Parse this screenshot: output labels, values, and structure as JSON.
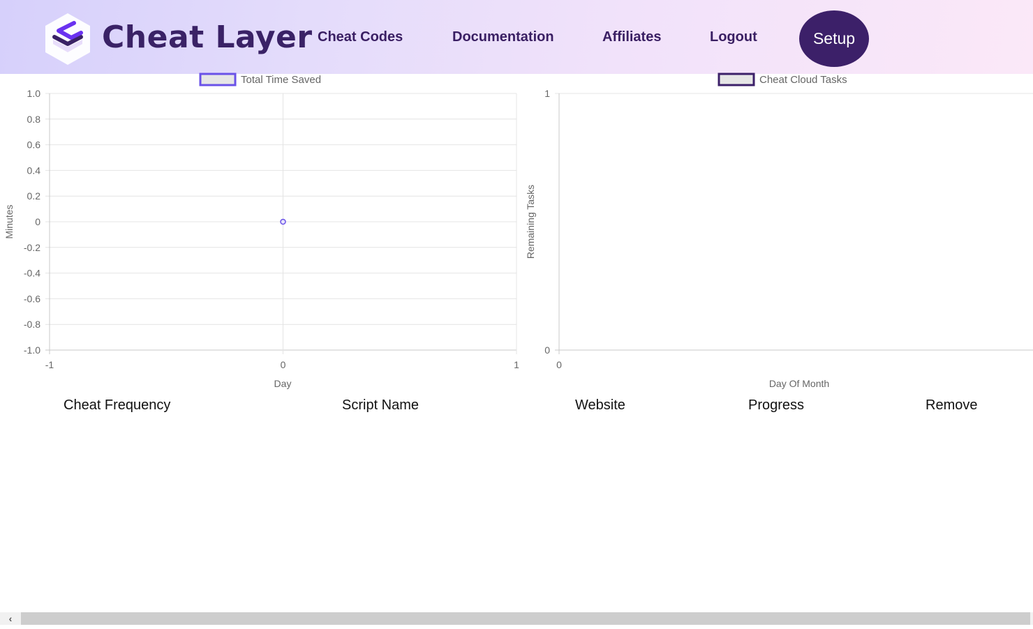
{
  "header": {
    "brand": "Cheat Layer",
    "logo_icon": "layers-icon",
    "nav": [
      {
        "label": "Cheat Codes"
      },
      {
        "label": "Documentation"
      },
      {
        "label": "Affiliates"
      },
      {
        "label": "Logout"
      }
    ],
    "setup_label": "Setup"
  },
  "colors": {
    "brand": "#3a2266",
    "accent": "#3c2069",
    "series1": "#6a52e8",
    "series2": "#3c2069"
  },
  "chart_data": [
    {
      "type": "line",
      "title": "",
      "legend": [
        "Total Time Saved"
      ],
      "legend_position": "top",
      "xlabel": "Day",
      "ylabel": "Minutes",
      "xlim": [
        -1,
        1
      ],
      "ylim": [
        -1.0,
        1.0
      ],
      "x_ticks": [
        "-1",
        "0",
        "1"
      ],
      "y_ticks": [
        "1.0",
        "0.8",
        "0.6",
        "0.4",
        "0.2",
        "0",
        "-0.2",
        "-0.4",
        "-0.6",
        "-0.8",
        "-1.0"
      ],
      "grid": true,
      "series": [
        {
          "name": "Total Time Saved",
          "x": [
            0
          ],
          "values": [
            0
          ]
        }
      ]
    },
    {
      "type": "line",
      "title": "",
      "legend": [
        "Cheat Cloud Tasks"
      ],
      "legend_position": "top",
      "xlabel": "Day Of Month",
      "ylabel": "Remaining Tasks",
      "xlim": [
        0,
        1
      ],
      "ylim": [
        0,
        1
      ],
      "x_ticks": [
        "0"
      ],
      "y_ticks": [
        "1",
        "0"
      ],
      "grid": true,
      "series": [
        {
          "name": "Cheat Cloud Tasks",
          "x": [],
          "values": []
        }
      ]
    }
  ],
  "table": {
    "columns": [
      "Cheat Frequency",
      "Script Name",
      "Website",
      "Progress",
      "Remove"
    ]
  },
  "scrollbar": {
    "left_arrow": "‹"
  }
}
